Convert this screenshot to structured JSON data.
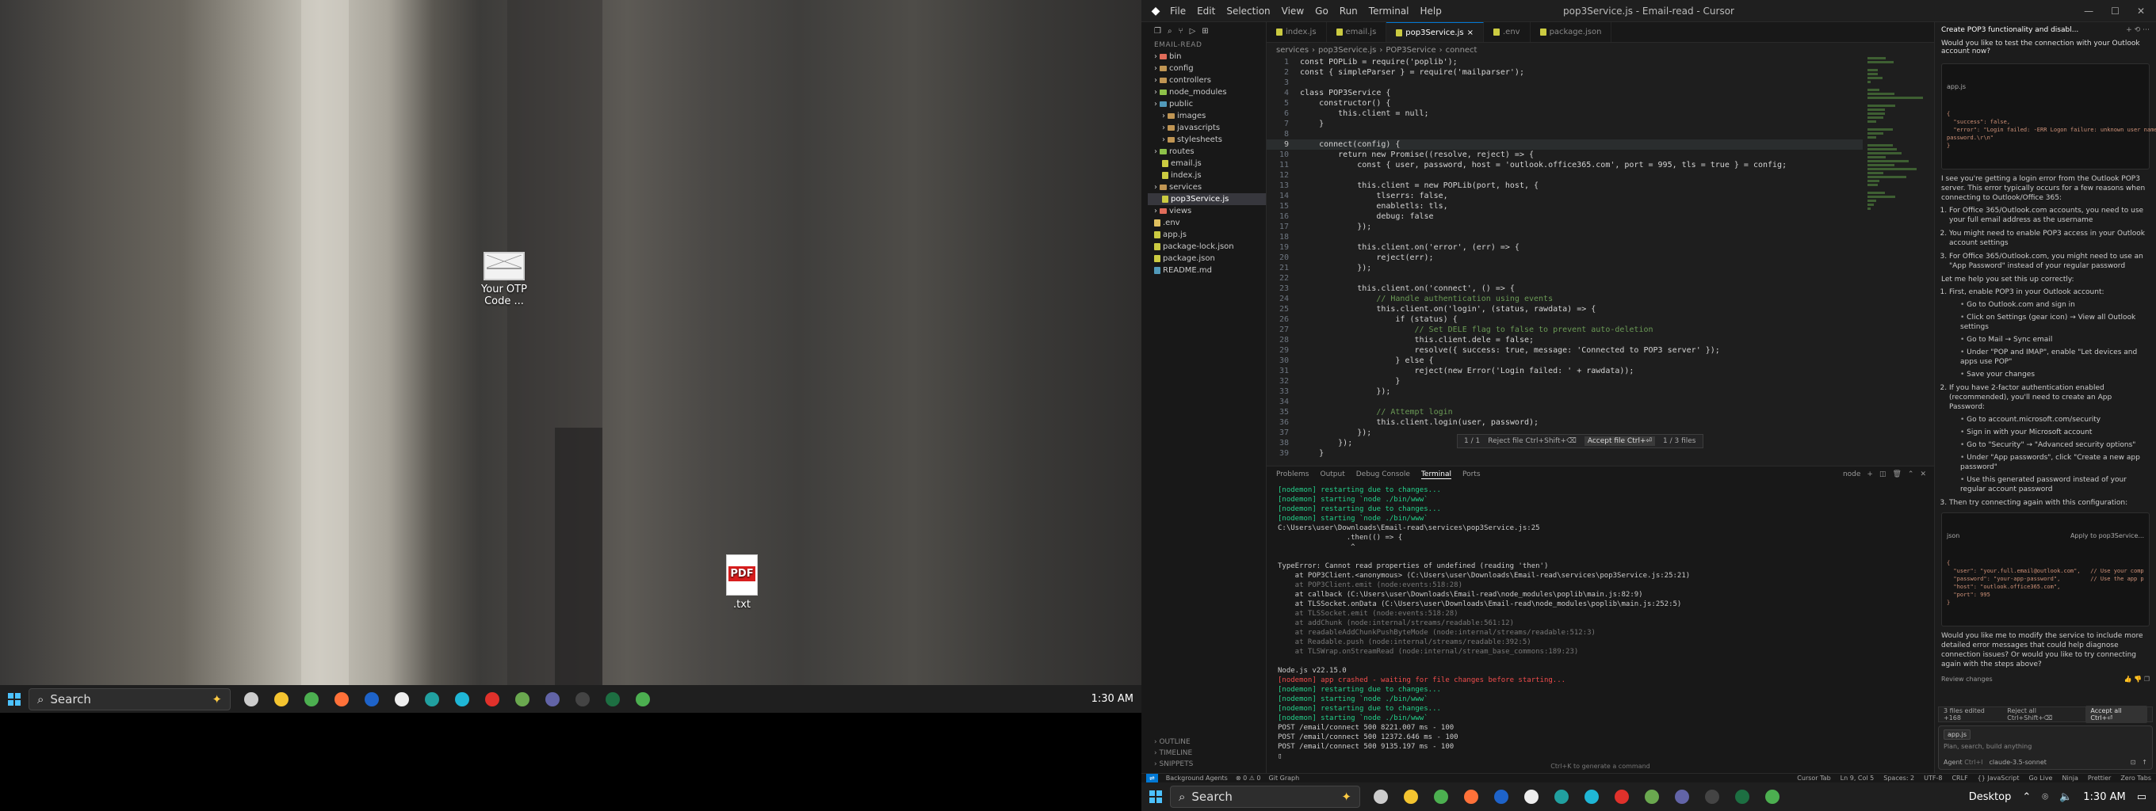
{
  "left_screen": {
    "desktop_icons": [
      {
        "label": "Your OTP Code ...",
        "icon": "mail-envelope-icon"
      },
      {
        "label": ".txt",
        "icon": "pdf-file-icon"
      }
    ],
    "taskbar": {
      "search_label": "Search",
      "clock": "1:30 AM",
      "apps": [
        {
          "name": "task-view",
          "color": "#cccccc"
        },
        {
          "name": "file-explorer",
          "color": "#f4c430"
        },
        {
          "name": "chrome",
          "color": "#4caf50"
        },
        {
          "name": "firefox",
          "color": "#ff7139"
        },
        {
          "name": "app-blue",
          "color": "#1e63c9"
        },
        {
          "name": "app-white",
          "color": "#eeeeee"
        },
        {
          "name": "app-teal",
          "color": "#21a0a0"
        },
        {
          "name": "cursor",
          "color": "#1fb6d6"
        },
        {
          "name": "app-red",
          "color": "#e0312b"
        },
        {
          "name": "app-multi",
          "color": "#6aa84f"
        },
        {
          "name": "teams",
          "color": "#6264a7"
        },
        {
          "name": "terminal",
          "color": "#444444"
        },
        {
          "name": "excel",
          "color": "#1d6f42"
        },
        {
          "name": "chrome-2",
          "color": "#4caf50"
        }
      ]
    }
  },
  "cursor": {
    "title": "pop3Service.js - Email-read - Cursor",
    "menu": [
      "File",
      "Edit",
      "Selection",
      "View",
      "Go",
      "Run",
      "Terminal",
      "Help"
    ],
    "explorer": {
      "header": "EMAIL-READ",
      "tree": [
        {
          "label": "bin",
          "depth": 0,
          "kind": "folder-red"
        },
        {
          "label": "config",
          "depth": 0,
          "kind": "folder"
        },
        {
          "label": "controllers",
          "depth": 0,
          "kind": "folder"
        },
        {
          "label": "node_modules",
          "depth": 0,
          "kind": "folder-green"
        },
        {
          "label": "public",
          "depth": 0,
          "kind": "folder-blue"
        },
        {
          "label": "images",
          "depth": 1,
          "kind": "folder"
        },
        {
          "label": "javascripts",
          "depth": 1,
          "kind": "folder"
        },
        {
          "label": "stylesheets",
          "depth": 1,
          "kind": "folder"
        },
        {
          "label": "routes",
          "depth": 0,
          "kind": "folder-green"
        },
        {
          "label": "email.js",
          "depth": 1,
          "kind": "js"
        },
        {
          "label": "index.js",
          "depth": 1,
          "kind": "js"
        },
        {
          "label": "services",
          "depth": 0,
          "kind": "folder"
        },
        {
          "label": "pop3Service.js",
          "depth": 1,
          "kind": "js",
          "selected": true
        },
        {
          "label": "views",
          "depth": 0,
          "kind": "folder-red"
        },
        {
          "label": ".env",
          "depth": 0,
          "kind": "env"
        },
        {
          "label": "app.js",
          "depth": 0,
          "kind": "js"
        },
        {
          "label": "package-lock.json",
          "depth": 0,
          "kind": "json"
        },
        {
          "label": "package.json",
          "depth": 0,
          "kind": "json"
        },
        {
          "label": "README.md",
          "depth": 0,
          "kind": "md"
        }
      ],
      "bottom": [
        "OUTLINE",
        "TIMELINE",
        "SNIPPETS"
      ]
    },
    "tabs": [
      {
        "label": "index.js",
        "active": false
      },
      {
        "label": "email.js",
        "active": false
      },
      {
        "label": "pop3Service.js",
        "active": true
      },
      {
        "label": ".env",
        "active": false
      },
      {
        "label": "package.json",
        "active": false
      }
    ],
    "breadcrumb": [
      "services",
      "pop3Service.js",
      "POP3Service",
      "connect"
    ],
    "code": [
      "const POPLib = require('poplib');",
      "const { simpleParser } = require('mailparser');",
      "",
      "class POP3Service {",
      "    constructor() {",
      "        this.client = null;",
      "    }",
      "",
      "    connect(config) {",
      "        return new Promise((resolve, reject) => {",
      "            const { user, password, host = 'outlook.office365.com', port = 995, tls = true } = config;",
      "",
      "            this.client = new POPLib(port, host, {",
      "                tlserrs: false,",
      "                enabletls: tls,",
      "                debug: false",
      "            });",
      "",
      "            this.client.on('error', (err) => {",
      "                reject(err);",
      "            });",
      "",
      "            this.client.on('connect', () => {",
      "                // Handle authentication using events",
      "                this.client.on('login', (status, rawdata) => {",
      "                    if (status) {",
      "                        // Set DELE flag to false to prevent auto-deletion",
      "                        this.client.dele = false;",
      "                        resolve({ success: true, message: 'Connected to POP3 server' });",
      "                    } else {",
      "                        reject(new Error('Login failed: ' + rawdata));",
      "                    }",
      "                });",
      "",
      "                // Attempt login",
      "                this.client.login(user, password);",
      "            });",
      "        });",
      "    }"
    ],
    "inline_diff": {
      "counter": "1 / 1",
      "reject": "Reject file  Ctrl+Shift+⌫",
      "accept": "Accept file  Ctrl+⏎",
      "files": "1 / 3 files"
    },
    "panel_tabs": [
      "Problems",
      "Output",
      "Debug Console",
      "Terminal",
      "Ports"
    ],
    "panel_shell": "node",
    "terminal": [
      {
        "t": "[nodemon] restarting due to changes...",
        "c": "g"
      },
      {
        "t": "[nodemon] starting `node ./bin/www`",
        "c": "g"
      },
      {
        "t": "[nodemon] restarting due to changes...",
        "c": "g"
      },
      {
        "t": "[nodemon] starting `node ./bin/www`",
        "c": "g"
      },
      {
        "t": "C:\\Users\\user\\Downloads\\Email-read\\services\\pop3Service.js:25",
        "c": ""
      },
      {
        "t": "                .then(() => {",
        "c": ""
      },
      {
        "t": "                 ^",
        "c": ""
      },
      {
        "t": "",
        "c": ""
      },
      {
        "t": "TypeError: Cannot read properties of undefined (reading 'then')",
        "c": ""
      },
      {
        "t": "    at POP3Client.<anonymous> (C:\\Users\\user\\Downloads\\Email-read\\services\\pop3Service.js:25:21)",
        "c": ""
      },
      {
        "t": "    at POP3Client.emit (node:events:518:28)",
        "c": "x"
      },
      {
        "t": "    at callback (C:\\Users\\user\\Downloads\\Email-read\\node_modules\\poplib\\main.js:82:9)",
        "c": ""
      },
      {
        "t": "    at TLSSocket.onData (C:\\Users\\user\\Downloads\\Email-read\\node_modules\\poplib\\main.js:252:5)",
        "c": ""
      },
      {
        "t": "    at TLSSocket.emit (node:events:518:28)",
        "c": "x"
      },
      {
        "t": "    at addChunk (node:internal/streams/readable:561:12)",
        "c": "x"
      },
      {
        "t": "    at readableAddChunkPushByteMode (node:internal/streams/readable:512:3)",
        "c": "x"
      },
      {
        "t": "    at Readable.push (node:internal/streams/readable:392:5)",
        "c": "x"
      },
      {
        "t": "    at TLSWrap.onStreamRead (node:internal/stream_base_commons:189:23)",
        "c": "x"
      },
      {
        "t": "",
        "c": ""
      },
      {
        "t": "Node.js v22.15.0",
        "c": ""
      },
      {
        "t": "[nodemon] app crashed - waiting for file changes before starting...",
        "c": "r"
      },
      {
        "t": "[nodemon] restarting due to changes...",
        "c": "g"
      },
      {
        "t": "[nodemon] starting `node ./bin/www`",
        "c": "g"
      },
      {
        "t": "[nodemon] restarting due to changes...",
        "c": "g"
      },
      {
        "t": "[nodemon] starting `node ./bin/www`",
        "c": "g"
      },
      {
        "t": "POST /email/connect 500 8221.007 ms - 100",
        "c": ""
      },
      {
        "t": "POST /email/connect 500 12372.646 ms - 100",
        "c": ""
      },
      {
        "t": "POST /email/connect 500 9135.197 ms - 100",
        "c": ""
      },
      {
        "t": "▯",
        "c": ""
      }
    ],
    "terminal_hint": "Ctrl+K to generate a command",
    "chat": {
      "title": "Create POP3 functionality and disabl...",
      "user_message": "Would you like to test the connection with your Outlook account now?",
      "code_card_title": "app.js",
      "code_card": "{\n  \"success\": false,\n  \"error\": \"Login failed: -ERR Logon failure: unknown user name or bad\npassword.\\r\\n\"\n}",
      "intro": "I see you're getting a login error from the Outlook POP3 server. This error typically occurs for a few reasons when connecting to Outlook/Office 365:",
      "reasons": [
        "For Office 365/Outlook.com accounts, you need to use your full email address as the username",
        "You might need to enable POP3 access in your Outlook account settings",
        "For Office 365/Outlook.com, you might need to use an \"App Password\" instead of your regular password"
      ],
      "setup_intro": "Let me help you set this up correctly:",
      "steps": [
        {
          "title": "First, enable POP3 in your Outlook account:",
          "sub": [
            "Go to Outlook.com and sign in",
            "Click on Settings (gear icon) → View all Outlook settings",
            "Go to Mail → Sync email",
            "Under \"POP and IMAP\", enable \"Let devices and apps use POP\"",
            "Save your changes"
          ]
        },
        {
          "title": "If you have 2-factor authentication enabled (recommended), you'll need to create an App Password:",
          "sub": [
            "Go to account.microsoft.com/security",
            "Sign in with your Microsoft account",
            "Go to \"Security\" → \"Advanced security options\"",
            "Under \"App passwords\", click \"Create a new app password\"",
            "Use this generated password instead of your regular account password"
          ]
        },
        {
          "title": "Then try connecting again with this configuration:",
          "sub": []
        }
      ],
      "json_card_title": "json",
      "json_card_action": "Apply to pop3Service...",
      "json_card": "{\n  \"user\": \"your.full.email@outlook.com\",   // Use your comp\n  \"password\": \"your-app-password\",         // Use the app p\n  \"host\": \"outlook.office365.com\",\n  \"port\": 995\n}",
      "closing": "Would you like me to modify the service to include more detailed error messages that could help diagnose connection issues? Or would you like to try connecting again with the steps above?",
      "review": "Review changes",
      "files_bar": "3 files edited  +168",
      "files_reject": "Reject all Ctrl+Shift+⌫",
      "files_accept": "Accept all  Ctrl+⏎",
      "input_pill": "app.js",
      "input_placeholder": "Plan, search, build anything",
      "agent_label": "Agent",
      "agent_shortcut": "Ctrl+I",
      "model_label": "claude-3.5-sonnet"
    },
    "status": {
      "left": [
        "Background Agents",
        "⊗ 0  ⚠ 0",
        "Git Graph"
      ],
      "right": [
        "Cursor Tab",
        "Ln 9, Col 5",
        "Spaces: 2",
        "UTF-8",
        "CRLF",
        "{} JavaScript",
        "Go Live",
        "Ninja",
        "Prettier",
        "Zero Tabs"
      ]
    }
  },
  "right_taskbar": {
    "search_label": "Search",
    "tray_label": "Desktop",
    "clock": "1:30 AM"
  }
}
